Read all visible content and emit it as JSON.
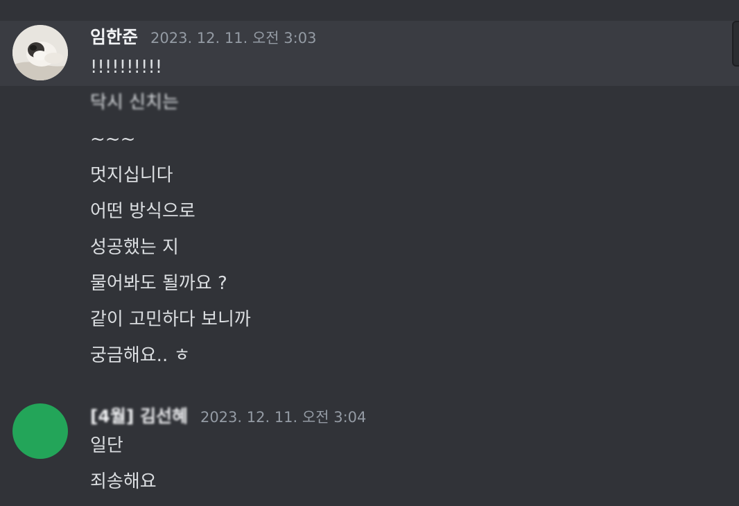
{
  "messages": [
    {
      "username": "임한준",
      "timestamp": "2023. 12. 11. 오전 3:03",
      "lines": [
        "!!!!!!!!!!",
        "닥시 신치는",
        "~~~",
        "멋지십니다",
        "어떤 방식으로",
        "성공했는 지",
        "물어봐도 될까요 ?",
        "같이 고민하다 보니까",
        "궁금해요.. ㅎ"
      ]
    },
    {
      "username": "[4월] 김선혜",
      "timestamp": "2023. 12. 11. 오전 3:04",
      "lines": [
        "일단",
        "죄송해요"
      ]
    }
  ],
  "colors": {
    "background": "#313338",
    "hover_background": "#3a3c42",
    "text": "#dbdee1",
    "username": "#f2f3f5",
    "timestamp": "#949ba4",
    "avatar_green": "#23a559"
  }
}
